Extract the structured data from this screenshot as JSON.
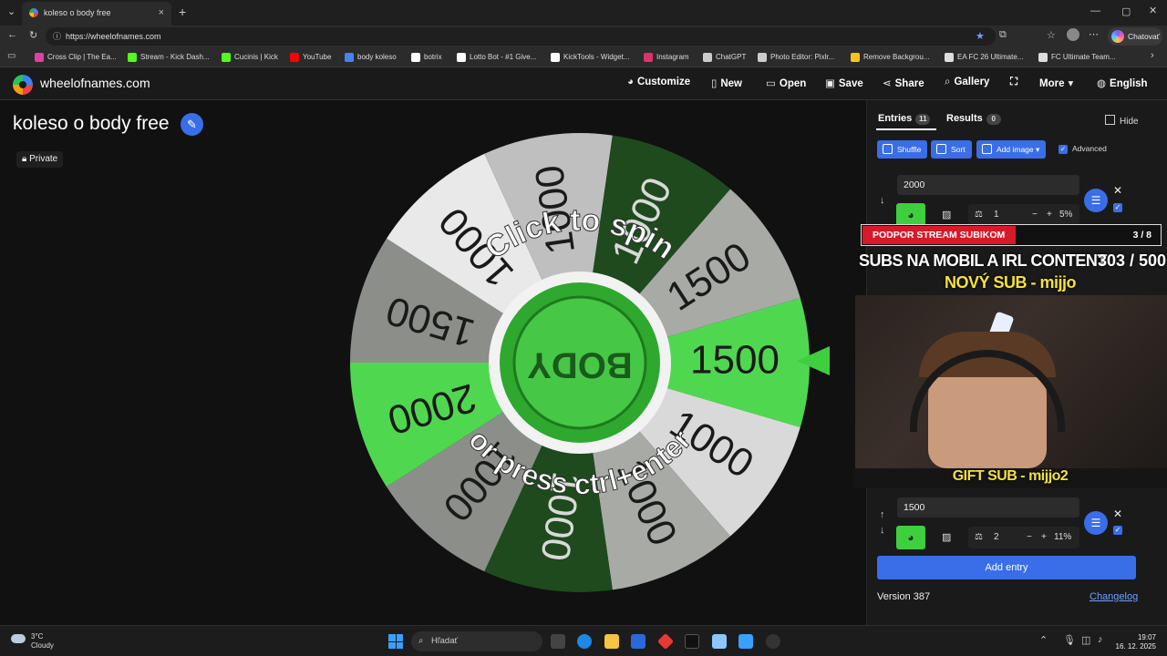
{
  "browser": {
    "tab_title": "koleso o body free",
    "url": "https://wheelofnames.com",
    "copilot_label": "Chatovať",
    "bookmarks": [
      {
        "label": "Cross Clip | The Ea...",
        "color": "#e040a0"
      },
      {
        "label": "Stream - Kick Dash...",
        "color": "#53fc18"
      },
      {
        "label": "Cucinis | Kick",
        "color": "#53fc18"
      },
      {
        "label": "YouTube",
        "color": "#ff0000"
      },
      {
        "label": "body koleso",
        "color": "#4285f4"
      },
      {
        "label": "botrix",
        "color": "#ffffff"
      },
      {
        "label": "Lotto Bot - #1 Give...",
        "color": "#ffffff"
      },
      {
        "label": "KickTools - Widget...",
        "color": "#ffffff"
      },
      {
        "label": "Instagram",
        "color": "#e1306c"
      },
      {
        "label": "ChatGPT",
        "color": "#cccccc"
      },
      {
        "label": "Photo Editor: Pixlr...",
        "color": "#cccccc"
      },
      {
        "label": "Remove Backgrou...",
        "color": "#f5c518"
      },
      {
        "label": "EA FC 26 Ultimate...",
        "color": "#dddddd"
      },
      {
        "label": "FC Ultimate Team...",
        "color": "#dddddd"
      }
    ]
  },
  "site": {
    "name": "wheelofnames.com",
    "nav": {
      "customize": "Customize",
      "new": "New",
      "open": "Open",
      "save": "Save",
      "share": "Share",
      "gallery": "Gallery",
      "more": "More",
      "language": "English"
    }
  },
  "wheel": {
    "title": "koleso o body free",
    "private_label": "Private",
    "center_text": "BODY",
    "prompt_top": "Click to spin",
    "prompt_bottom": "or press ctrl+enter",
    "segments": [
      {
        "label": "1500",
        "color": "#4fd84f"
      },
      {
        "label": "1000",
        "color": "#d9d9d9"
      },
      {
        "label": "1000",
        "color": "#a8aaa6"
      },
      {
        "label": "1000",
        "color": "#1e4a1e"
      },
      {
        "label": "1000",
        "color": "#8c8e8a"
      },
      {
        "label": "2000",
        "color": "#4fd84f"
      },
      {
        "label": "1500",
        "color": "#8c8e8a"
      },
      {
        "label": "1000",
        "color": "#e9e9e9"
      },
      {
        "label": "1000",
        "color": "#bfbfbf"
      },
      {
        "label": "1000",
        "color": "#1e4a1e"
      },
      {
        "label": "1500",
        "color": "#a8aaa6"
      }
    ]
  },
  "panel": {
    "tab_entries": "Entries",
    "entries_count": "11",
    "tab_results": "Results",
    "results_count": "0",
    "hide_label": "Hide",
    "shuffle": "Shuffle",
    "sort": "Sort",
    "add_image": "Add image",
    "advanced": "Advanced",
    "entry1": {
      "text": "2000",
      "weight": "1",
      "percent": "5%"
    },
    "entry2": {
      "text": "1500",
      "weight": "2",
      "percent": "11%"
    },
    "add_entry": "Add entry",
    "version": "Version 387",
    "changelog": "Changelog"
  },
  "overlay": {
    "alert_text": "PODPOR STREAM SUBIKOM",
    "alert_count": "3 / 8",
    "goal_text": "SUBS NA MOBIL A IRL CONTENT",
    "goal_count": "303 / 500",
    "new_sub": "NOVÝ SUB - mijjo",
    "gift_sub": "GIFT SUB - mijjo2"
  },
  "taskbar": {
    "temp": "3°C",
    "weather": "Cloudy",
    "search_placeholder": "Hľadať",
    "time": "19:07",
    "date": "16. 12. 2025"
  }
}
